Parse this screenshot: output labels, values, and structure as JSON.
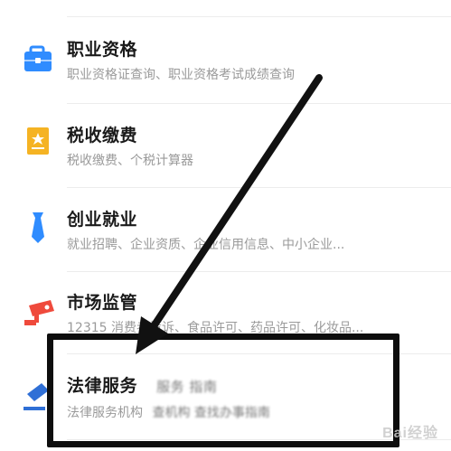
{
  "items": [
    {
      "title": "职业资格",
      "subtitle": "职业资格证查询、职业资格考试成绩查询",
      "icon": "briefcase-icon",
      "color": "#2f8cff"
    },
    {
      "title": "税收缴费",
      "subtitle": "税收缴费、个税计算器",
      "icon": "tax-document-icon",
      "color": "#f5b323"
    },
    {
      "title": "创业就业",
      "subtitle": "就业招聘、企业资质、企业信用信息、中小企业...",
      "icon": "necktie-icon",
      "color": "#2f8cff"
    },
    {
      "title": "市场监管",
      "subtitle": "12315 消费者投诉、食品许可、药品许可、化妆品...",
      "icon": "surveillance-camera-icon",
      "color": "#ef4a3c"
    },
    {
      "title": "法律服务",
      "title_extra": "服务 指南",
      "subtitle": "法律服务机构",
      "subtitle_extra": "查机构 查找办事指南",
      "icon": "gavel-icon",
      "color": "#2f6fd6"
    }
  ],
  "watermark": "Bai经验"
}
